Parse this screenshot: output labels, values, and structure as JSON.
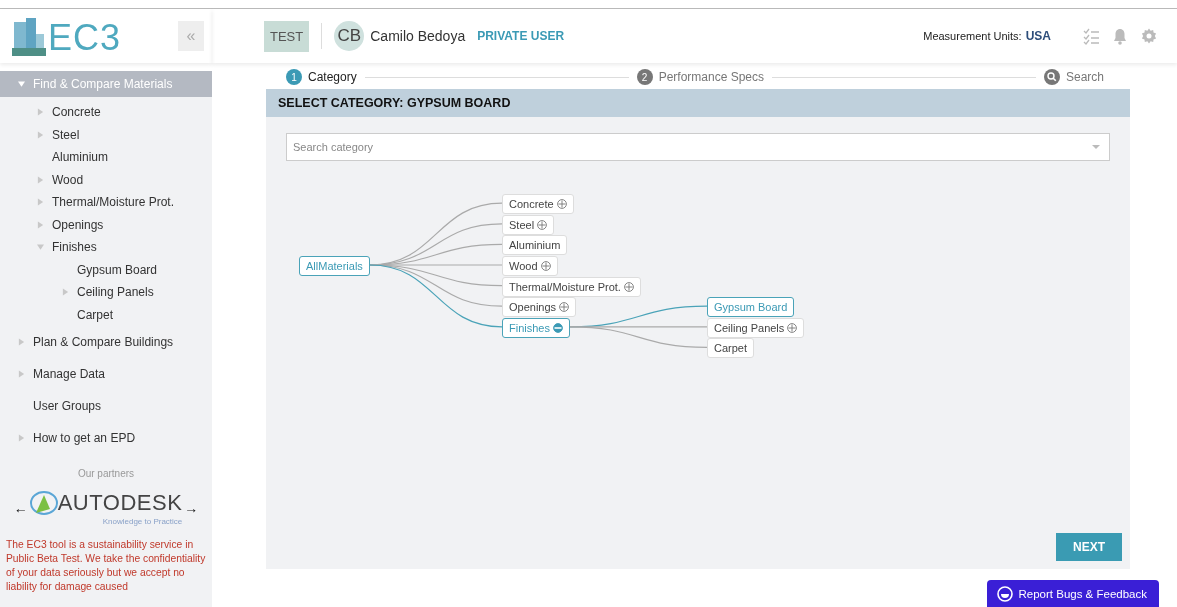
{
  "logo": {
    "text": "EC3"
  },
  "collapse_button": "«",
  "header": {
    "badge": "TEST",
    "avatar": "CB",
    "user_name": "Camilo Bedoya",
    "role": "PRIVATE USER",
    "units_label": "Measurement Units:",
    "units_value": "USA"
  },
  "sidebar": {
    "items": [
      {
        "label": "Find & Compare Materials",
        "selected": true,
        "expandable": true,
        "expanded": true,
        "children": [
          {
            "label": "Concrete",
            "expandable": true,
            "expanded": false
          },
          {
            "label": "Steel",
            "expandable": true,
            "expanded": false
          },
          {
            "label": "Aluminium",
            "expandable": false
          },
          {
            "label": "Wood",
            "expandable": true,
            "expanded": false
          },
          {
            "label": "Thermal/Moisture Prot.",
            "expandable": true,
            "expanded": false
          },
          {
            "label": "Openings",
            "expandable": true,
            "expanded": false
          },
          {
            "label": "Finishes",
            "expandable": true,
            "expanded": true,
            "children": [
              {
                "label": "Gypsum Board",
                "expandable": false
              },
              {
                "label": "Ceiling Panels",
                "expandable": true,
                "expanded": false
              },
              {
                "label": "Carpet",
                "expandable": false
              }
            ]
          }
        ]
      },
      {
        "label": "Plan & Compare Buildings",
        "selected": false,
        "expandable": true,
        "expanded": false
      },
      {
        "label": "Manage Data",
        "selected": false,
        "expandable": true,
        "expanded": false
      },
      {
        "label": "User Groups",
        "selected": false,
        "expandable": false
      },
      {
        "label": "How to get an EPD",
        "selected": false,
        "expandable": true,
        "expanded": false
      }
    ],
    "partners_title": "Our partners",
    "partner": {
      "prev": "←",
      "name": "AUTODESK",
      "tagline": "Knowledge to Practice",
      "next": "→"
    },
    "disclaimer": "The EC3 tool is a sustainability service in Public Beta Test. We take the confidentiality of your data seriously but we accept no liability for damage caused"
  },
  "stepper": [
    {
      "kind": "number",
      "marker": "1",
      "label": "Category",
      "active": true
    },
    {
      "kind": "number",
      "marker": "2",
      "label": "Performance Specs",
      "active": false
    },
    {
      "kind": "search",
      "label": "Search",
      "active": false
    }
  ],
  "panel": {
    "title": "SELECT CATEGORY: GYPSUM BOARD",
    "search": {
      "placeholder": "Search category"
    },
    "mind_map": {
      "root": {
        "label": "AllMaterials",
        "selected": true
      },
      "children": [
        {
          "label": "Concrete",
          "selected": false,
          "expandable": true,
          "expanded": false
        },
        {
          "label": "Steel",
          "selected": false,
          "expandable": true,
          "expanded": false
        },
        {
          "label": "Aluminium",
          "selected": false,
          "expandable": false
        },
        {
          "label": "Wood",
          "selected": false,
          "expandable": true,
          "expanded": false
        },
        {
          "label": "Thermal/Moisture Prot.",
          "selected": false,
          "expandable": true,
          "expanded": false
        },
        {
          "label": "Openings",
          "selected": false,
          "expandable": true,
          "expanded": false
        },
        {
          "label": "Finishes",
          "selected": true,
          "expandable": true,
          "expanded": true,
          "children": [
            {
              "label": "Gypsum Board",
              "selected": true,
              "expandable": false
            },
            {
              "label": "Ceiling Panels",
              "selected": false,
              "expandable": true,
              "expanded": false
            },
            {
              "label": "Carpet",
              "selected": false,
              "expandable": false
            }
          ]
        }
      ]
    },
    "next_button": "NEXT"
  },
  "feedback_button": "Report Bugs & Feedback"
}
